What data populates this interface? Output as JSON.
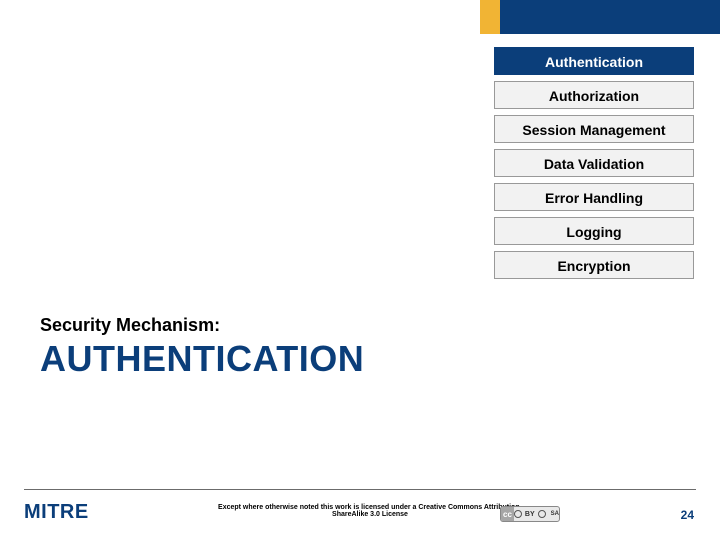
{
  "colors": {
    "brand_blue": "#0b3e7a",
    "accent_yellow": "#f1b434",
    "item_inactive_bg": "#f2f2f2"
  },
  "stacked_list": {
    "active_index": 0,
    "items": [
      {
        "label": "Authentication"
      },
      {
        "label": "Authorization"
      },
      {
        "label": "Session Management"
      },
      {
        "label": "Data Validation"
      },
      {
        "label": "Error Handling"
      },
      {
        "label": "Logging"
      },
      {
        "label": "Encryption"
      }
    ]
  },
  "heading": {
    "kicker": "Security Mechanism:",
    "title": "AUTHENTICATION"
  },
  "footer": {
    "logo_text": "MITRE",
    "license_text": "Except where otherwise noted this work is licensed under a Creative Commons Attribution-ShareAlike 3.0 License",
    "cc_left": "cc",
    "cc_by": "BY",
    "cc_sa": "SA",
    "page_number": "24"
  }
}
